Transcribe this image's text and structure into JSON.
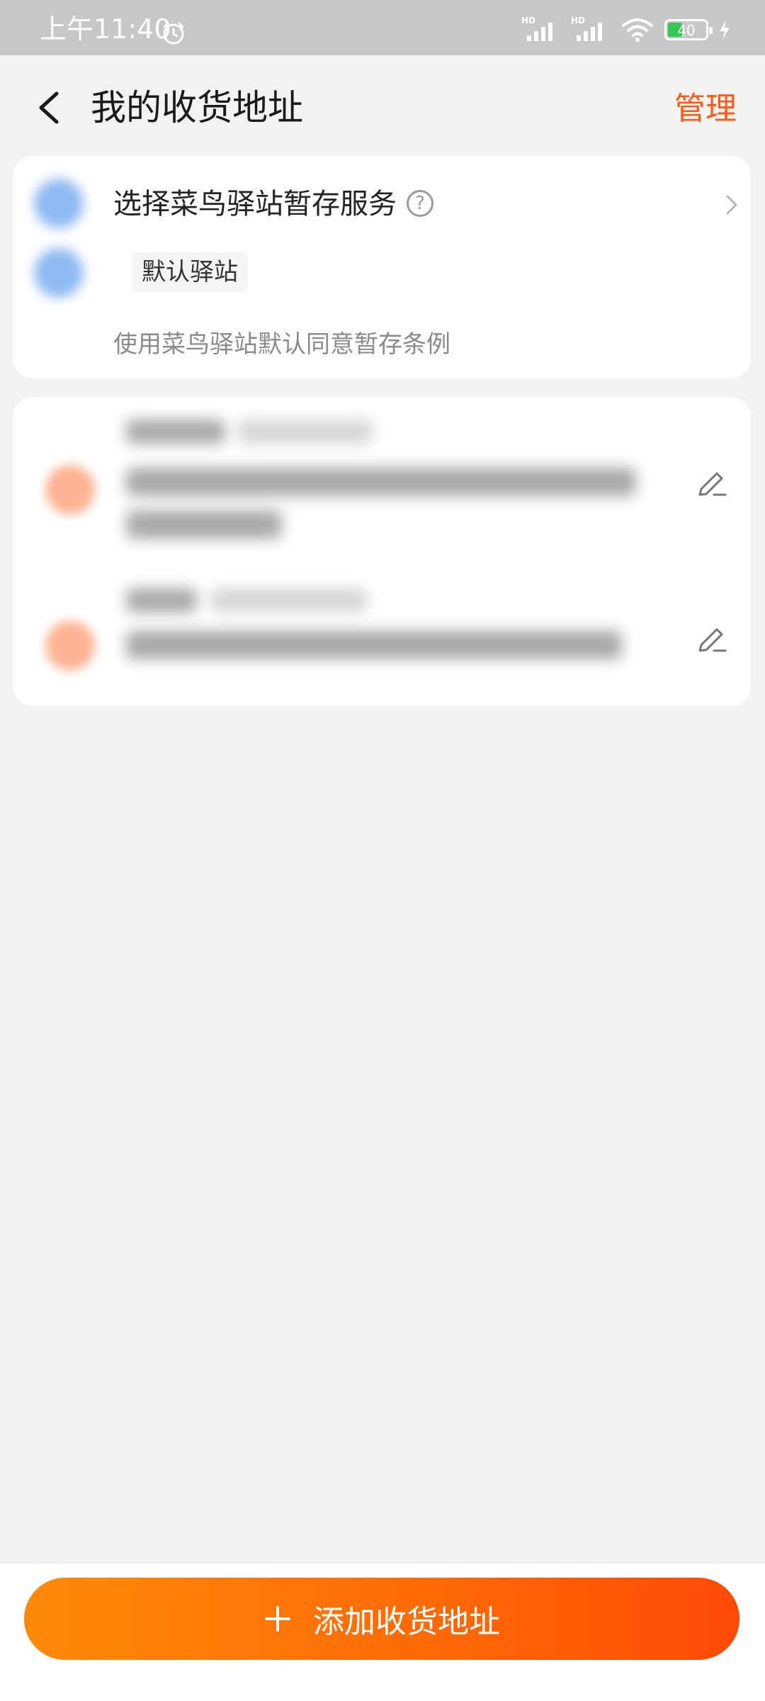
{
  "status_bar": {
    "time": "上午11:40",
    "signal_1_label": "HD",
    "signal_2_label": "HD",
    "battery": "40"
  },
  "header": {
    "title": "我的收货地址",
    "manage_label": "管理"
  },
  "station_card": {
    "title": "选择菜鸟驿站暂存服务",
    "help_glyph": "?",
    "default_station_label": "默认驿站",
    "note": "使用菜鸟驿站默认同意暂存条例"
  },
  "bottom": {
    "add_address_label": "添加收货地址"
  },
  "colors": {
    "accent": "#ff5a14",
    "button_gradient_start": "#ff8a0a",
    "button_gradient_end": "#ff4a07"
  }
}
